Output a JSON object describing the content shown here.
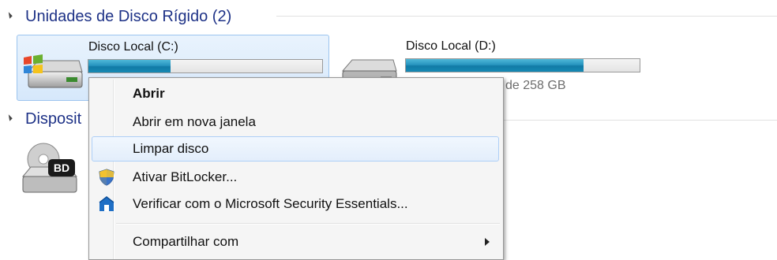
{
  "groups": {
    "hard_drives": {
      "title": "Unidades de Disco Rígido (2)"
    },
    "devices": {
      "title": "Disposit"
    }
  },
  "drives": [
    {
      "name": "Disco Local (C:)",
      "used_fraction": 0.35,
      "icon": "windows-hard-drive-icon"
    },
    {
      "name": "Disco Local (D:)",
      "used_fraction": 0.76,
      "space_text": "de 258 GB",
      "icon": "hard-drive-icon"
    }
  ],
  "devices": [
    {
      "badge": "BD",
      "icon": "bd-drive-icon"
    }
  ],
  "context_menu": {
    "items": [
      {
        "label": "Abrir",
        "bold": true
      },
      {
        "label": "Abrir em nova janela"
      },
      {
        "label": "Limpar disco",
        "highlighted": true
      },
      {
        "label": "Ativar BitLocker...",
        "icon": "shield-icon"
      },
      {
        "label": "Verificar com o Microsoft Security Essentials...",
        "icon": "security-essentials-icon"
      },
      {
        "label": "Compartilhar com",
        "submenu": true
      }
    ]
  },
  "colors": {
    "header_text": "#1e3287",
    "bar_fill": "#1689b4",
    "hover_border": "#aecff7"
  }
}
